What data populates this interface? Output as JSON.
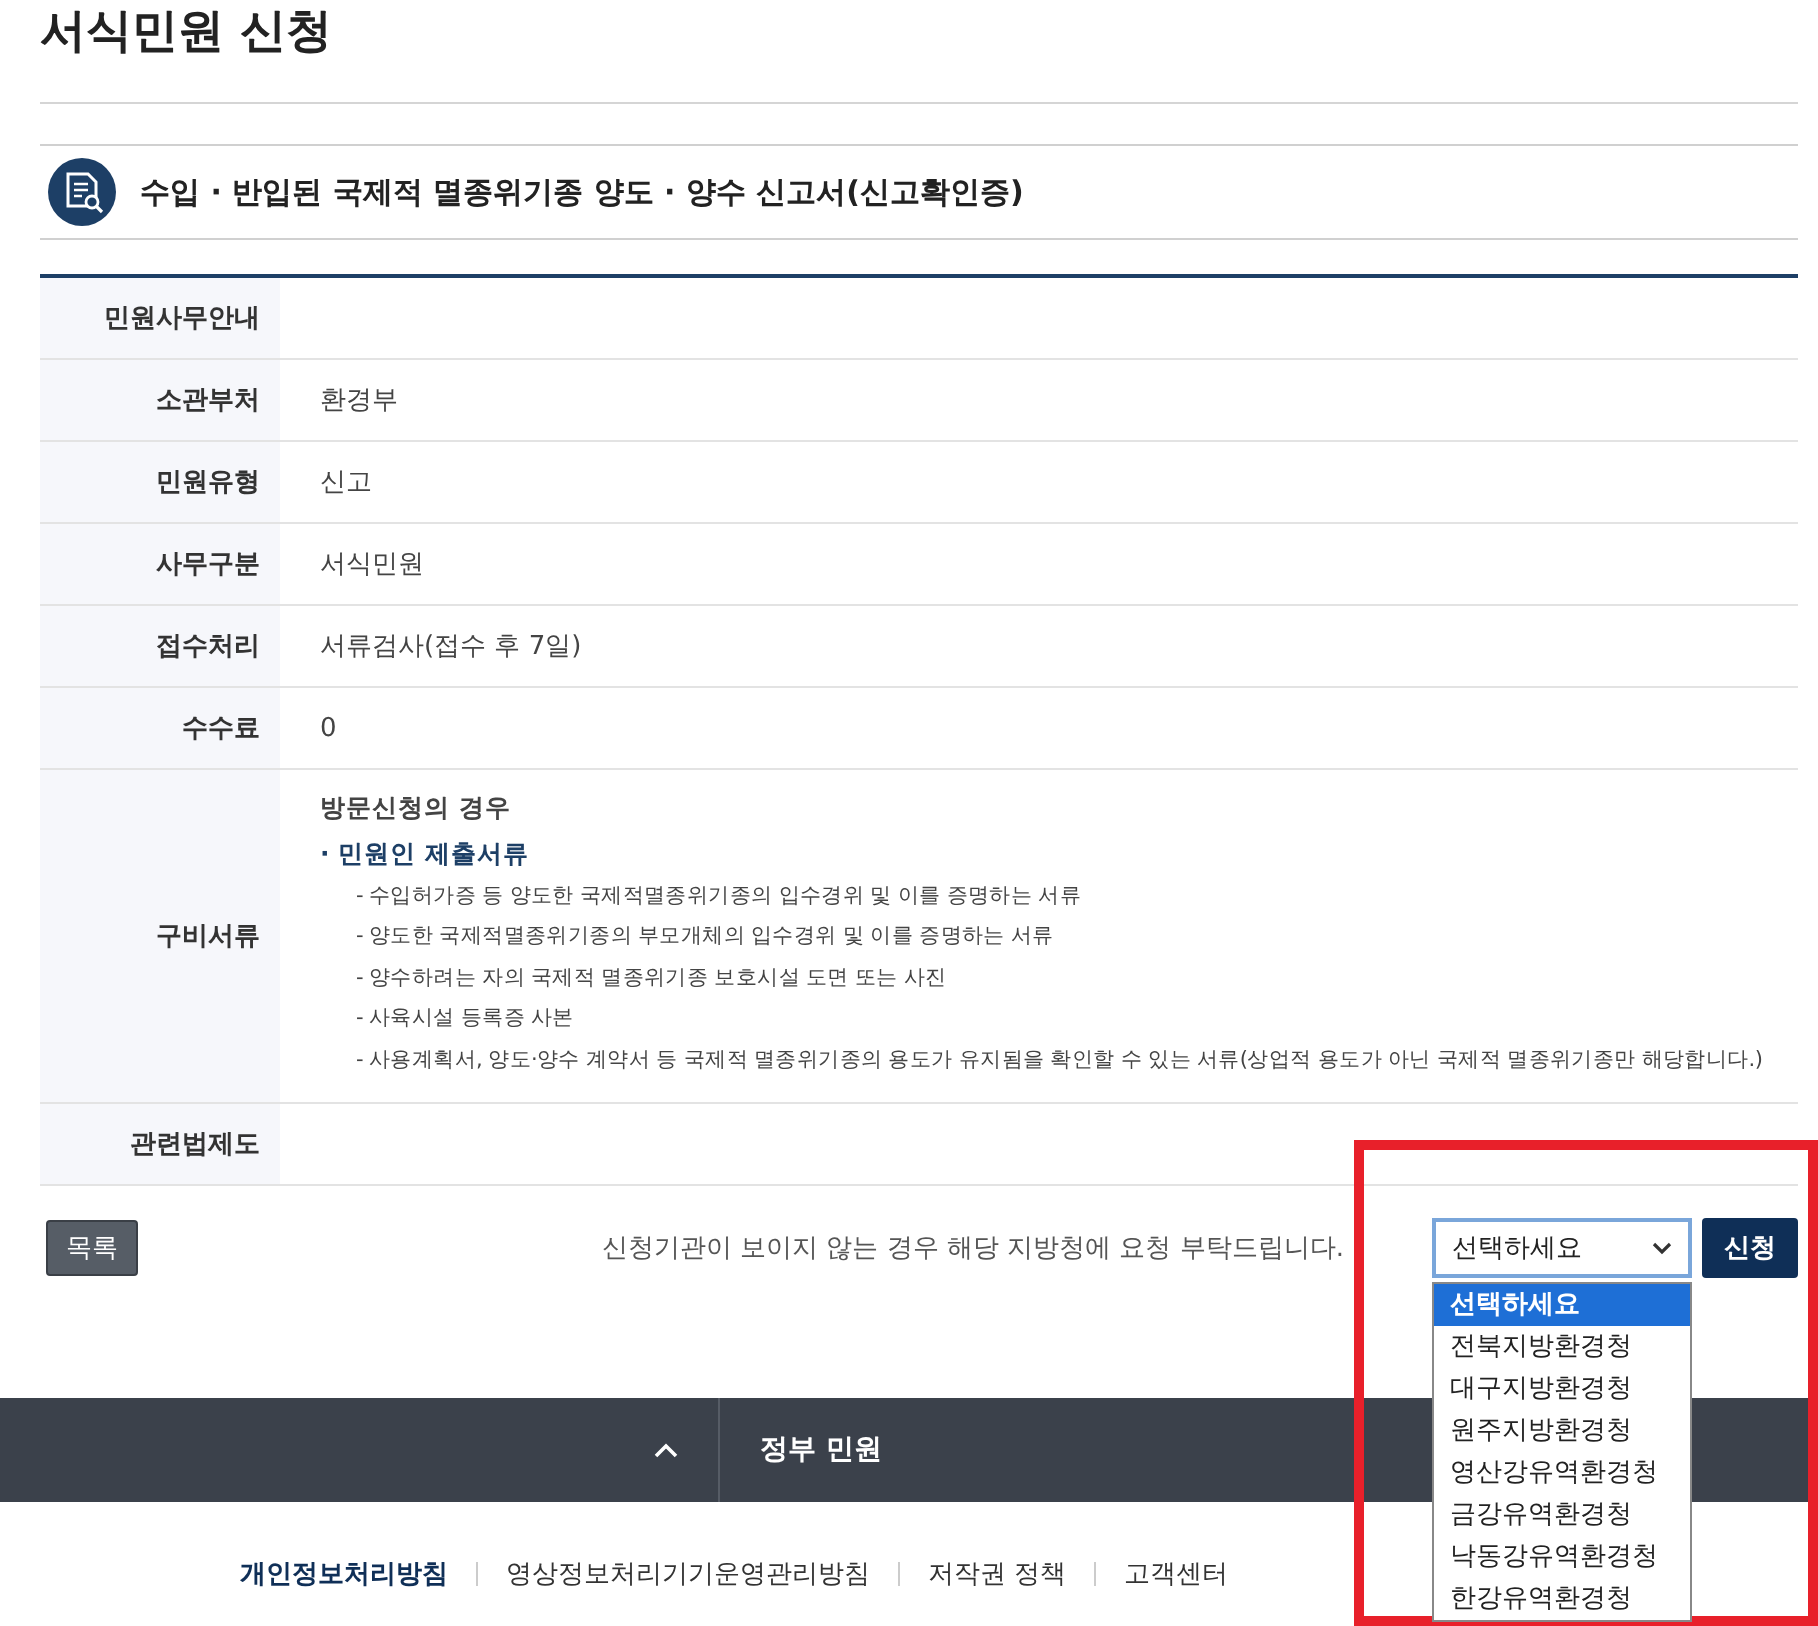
{
  "page_title": "서식민원 신청",
  "form_title": "수입 · 반입된 국제적 멸종위기종 양도 · 양수 신고서(신고확인증)",
  "info_rows": [
    {
      "kind": "text",
      "label": "민원사무안내"
    },
    {
      "kind": "text",
      "label": "소관부처",
      "value": "환경부"
    },
    {
      "kind": "text",
      "label": "민원유형",
      "value": "신고"
    },
    {
      "kind": "text",
      "label": "사무구분",
      "value": "서식민원"
    },
    {
      "kind": "text",
      "label": "접수처리",
      "value": "서류검사(접수 후 7일)"
    },
    {
      "kind": "text",
      "label": "수수료",
      "value": "0"
    },
    {
      "kind": "documents",
      "label": "구비서류",
      "heading": "방문신청의 경우",
      "section": "· 민원인 제출서류",
      "items": [
        "- 수입허가증 등 양도한 국제적멸종위기종의 입수경위 및 이를 증명하는 서류",
        "- 양도한 국제적멸종위기종의 부모개체의 입수경위 및 이를 증명하는 서류",
        "- 양수하려는 자의 국제적 멸종위기종 보호시설 도면 또는 사진",
        "- 사육시설 등록증 사본",
        "- 사용계획서, 양도·양수 계약서 등 국제적 멸종위기종의 용도가 유지됨을 확인할 수 있는 서류(상업적 용도가 아닌 국제적 멸종위기종만 해당합니다.)"
      ]
    },
    {
      "kind": "text",
      "label": "관련법제도"
    }
  ],
  "list_button": "목록",
  "notice": "신청기관이 보이지 않는 경우 해당 지방청에 요청 부탁드립니다.",
  "agency_select": {
    "value": "선택하세요",
    "expanded": true,
    "options": [
      {
        "label": "선택하세요",
        "selected": true
      },
      {
        "label": "전북지방환경청",
        "selected": false
      },
      {
        "label": "대구지방환경청",
        "selected": false
      },
      {
        "label": "원주지방환경청",
        "selected": false
      },
      {
        "label": "영산강유역환경청",
        "selected": false
      },
      {
        "label": "금강유역환경청",
        "selected": false
      },
      {
        "label": "낙동강유역환경청",
        "selected": false
      },
      {
        "label": "한강유역환경청",
        "selected": false
      }
    ]
  },
  "apply_button": "신청",
  "footer": {
    "menu_title": "정부 민원",
    "links": [
      {
        "label": "개인정보처리방침",
        "emphasized": true
      },
      {
        "label": "영상정보처리기기운영관리방침",
        "emphasized": false
      },
      {
        "label": "저작권 정책",
        "emphasized": false
      },
      {
        "label": "고객센터",
        "emphasized": false
      }
    ]
  }
}
